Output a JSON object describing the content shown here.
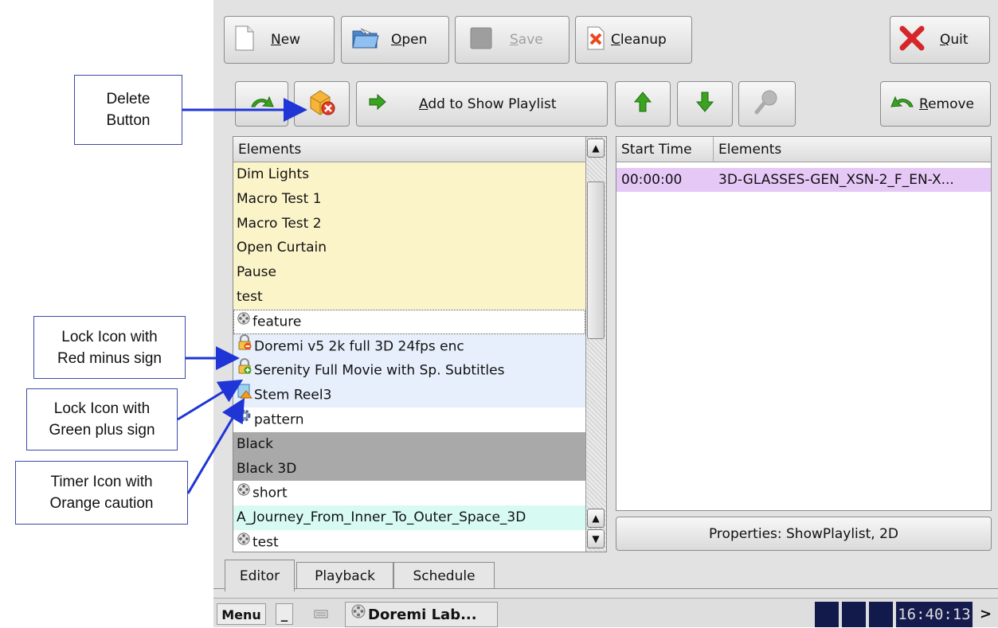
{
  "toolbar": {
    "new": {
      "prefix": "",
      "ul": "N",
      "rest": "ew"
    },
    "open": {
      "prefix": "",
      "ul": "O",
      "rest": "pen"
    },
    "save": {
      "prefix": "",
      "ul": "S",
      "rest": "ave"
    },
    "cleanup": {
      "prefix": "",
      "ul": "C",
      "rest": "leanup"
    },
    "quit": {
      "prefix": "",
      "ul": "Q",
      "rest": "uit"
    }
  },
  "actions": {
    "add": {
      "prefix": "",
      "ul": "A",
      "rest": "dd to Show Playlist"
    },
    "remove": {
      "prefix": "",
      "ul": "R",
      "rest": "emove"
    }
  },
  "elements_panel": {
    "header": "Elements",
    "items": [
      {
        "label": "Dim Lights",
        "icon": "",
        "bg": "#fbf4c9"
      },
      {
        "label": "Macro Test 1",
        "icon": "",
        "bg": "#fbf4c9"
      },
      {
        "label": "Macro Test 2",
        "icon": "",
        "bg": "#fbf4c9"
      },
      {
        "label": "Open Curtain",
        "icon": "",
        "bg": "#fbf4c9"
      },
      {
        "label": "Pause",
        "icon": "",
        "bg": "#fbf4c9"
      },
      {
        "label": "test",
        "icon": "",
        "bg": "#fbf4c9"
      },
      {
        "label": "feature",
        "icon": "reel-icon",
        "bg": "#ffffff"
      },
      {
        "label": "Doremi v5 2k full 3D 24fps enc",
        "icon": "lock-red-minus-icon",
        "bg": "#e6effb"
      },
      {
        "label": "Serenity Full Movie with Sp. Subtitles",
        "icon": "lock-green-plus-icon",
        "bg": "#e6effb"
      },
      {
        "label": "Stem Reel3",
        "icon": "timer-caution-icon",
        "bg": "#e6effb"
      },
      {
        "label": "pattern",
        "icon": "gear-icon",
        "bg": "#ffffff"
      },
      {
        "label": "Black",
        "icon": "",
        "bg": "#a9a9a9"
      },
      {
        "label": "Black 3D",
        "icon": "",
        "bg": "#a9a9a9"
      },
      {
        "label": "short",
        "icon": "reel-icon",
        "bg": "#ffffff"
      },
      {
        "label": "A_Journey_From_Inner_To_Outer_Space_3D",
        "icon": "",
        "bg": "#d7fbf3"
      },
      {
        "label": "test",
        "icon": "reel-icon",
        "bg": "#ffffff"
      }
    ]
  },
  "playlist_panel": {
    "columns": [
      "Start Time",
      "Elements"
    ],
    "rows": [
      {
        "start_time": "00:00:00",
        "element": "3D-GLASSES-GEN_XSN-2_F_EN-X..."
      }
    ],
    "selected_row_color": "#e6c8f7"
  },
  "properties_button": "Properties: ShowPlaylist, 2D",
  "tabs": [
    "Editor",
    "Playback",
    "Schedule"
  ],
  "taskbar": {
    "menu": "Menu",
    "minimize": "_",
    "task": "Doremi Lab...",
    "clock": "16:40:13",
    "more": ">"
  },
  "callouts": {
    "delete": [
      "Delete",
      "Button"
    ],
    "lock_red": [
      "Lock Icon with",
      "Red minus sign"
    ],
    "lock_green": [
      "Lock Icon with",
      "Green plus sign"
    ],
    "timer": [
      "Timer Icon with",
      "Orange caution"
    ]
  },
  "colors": {
    "arrow": "#1f35d6",
    "accent_green": "#3aa31f"
  }
}
